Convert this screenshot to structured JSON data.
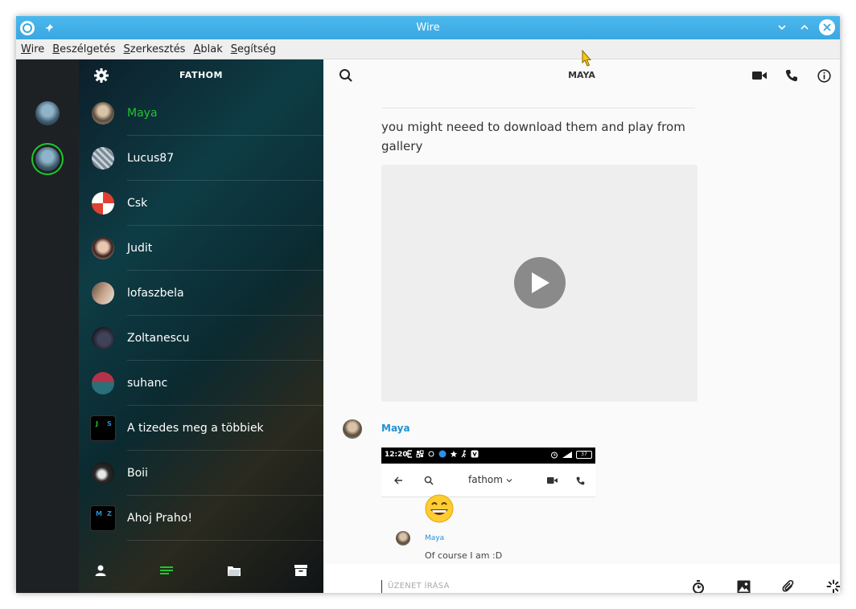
{
  "window": {
    "title": "Wire"
  },
  "menu": [
    "Wire",
    "Beszélgetés",
    "Szerkesztés",
    "Ablak",
    "Segítség"
  ],
  "list": {
    "username": "FATHOM",
    "conversations": [
      {
        "name": "Maya",
        "active": true
      },
      {
        "name": "Lucus87",
        "active": false
      },
      {
        "name": "Csk",
        "active": false
      },
      {
        "name": "Judit",
        "active": false
      },
      {
        "name": "lofaszbela",
        "active": false
      },
      {
        "name": "Zoltanescu",
        "active": false
      },
      {
        "name": "suhanc",
        "active": false
      },
      {
        "name": "A tizedes meg a többiek",
        "active": false,
        "group_initials": [
          "J",
          "S"
        ],
        "initial_colors": [
          "#1ec72f",
          "#2391d3"
        ]
      },
      {
        "name": "Boii",
        "active": false
      },
      {
        "name": "Ahoj Praho!",
        "active": false,
        "group_initials": [
          "M",
          "Z"
        ],
        "initial_colors": [
          "#2391d3",
          "#2391d3"
        ]
      }
    ]
  },
  "chat": {
    "title": "MAYA",
    "message_text": "you might neeed to download them and play from gallery",
    "sender": "Maya",
    "embedded": {
      "time": "12:20",
      "battery": "37",
      "conversation_name": "fathom",
      "sender": "Maya",
      "text": "Of course I am :D"
    },
    "composer_placeholder": "ÜZENET ÍRÁSA"
  },
  "colors": {
    "accent_green": "#1ec72f",
    "accent_blue": "#2391d3",
    "titlebar": "#3aa7e3"
  }
}
